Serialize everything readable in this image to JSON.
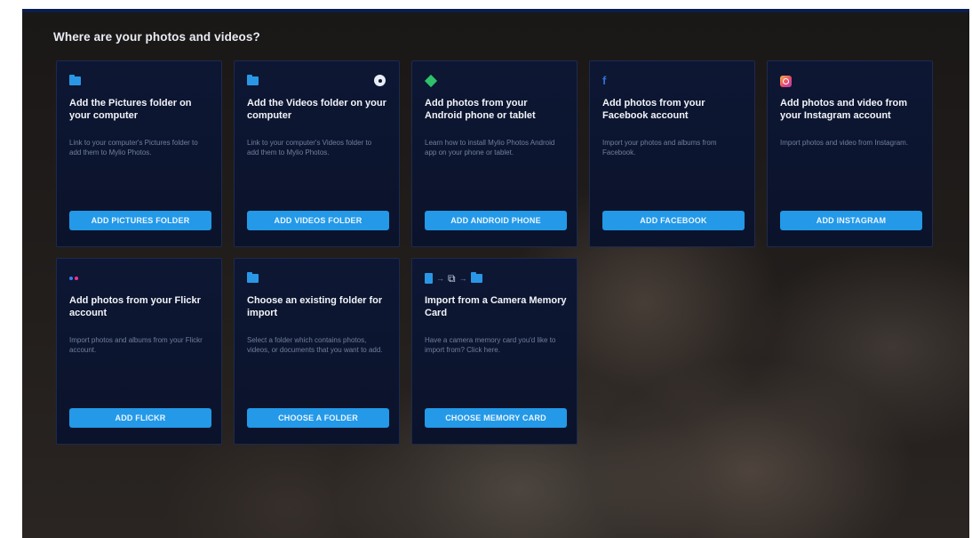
{
  "heading": "Where are your photos and videos?",
  "cards": [
    {
      "icon": "folder-icon",
      "title": "Add the Pictures folder on your computer",
      "desc": "Link to your computer's Pictures folder to add them to Mylio Photos.",
      "button": "ADD PICTURES FOLDER"
    },
    {
      "icon": "folder-icon",
      "title": "Add the Videos folder on your computer",
      "desc": "Link to your computer's Videos folder to add them to Mylio Photos.",
      "button": "ADD VIDEOS FOLDER"
    },
    {
      "icon": "android-icon",
      "title": "Add photos from your Android phone or tablet",
      "desc": "Learn how to install Mylio Photos Android app on your phone or tablet.",
      "button": "ADD ANDROID PHONE"
    },
    {
      "icon": "facebook-icon",
      "glyph": "f",
      "title": "Add photos from your Facebook account",
      "desc": "Import your photos and albums from Facebook.",
      "button": "ADD FACEBOOK"
    },
    {
      "icon": "instagram-icon",
      "title": "Add photos and video from your Instagram account",
      "desc": "Import photos and video from Instagram.",
      "button": "ADD INSTAGRAM"
    },
    {
      "icon": "flickr-icon",
      "title": "Add photos from your Flickr account",
      "desc": "Import photos and albums from your Flickr account.",
      "button": "ADD FLICKR"
    },
    {
      "icon": "folder-icon",
      "title": "Choose an existing folder for import",
      "desc": "Select a folder which contains photos, videos, or documents that you want to add.",
      "button": "CHOOSE A FOLDER"
    },
    {
      "icon": "memory-card-icon",
      "title": "Import from a Camera Memory Card",
      "desc": "Have a camera memory card you'd like to import from? Click here.",
      "button": "CHOOSE MEMORY CARD"
    }
  ],
  "colors": {
    "accent": "#2399e8",
    "card_bg": "#0d1733",
    "android": "#2fc06a",
    "facebook": "#2f6fd0",
    "flickr_blue": "#3a7cf0",
    "flickr_pink": "#ff2e93"
  }
}
